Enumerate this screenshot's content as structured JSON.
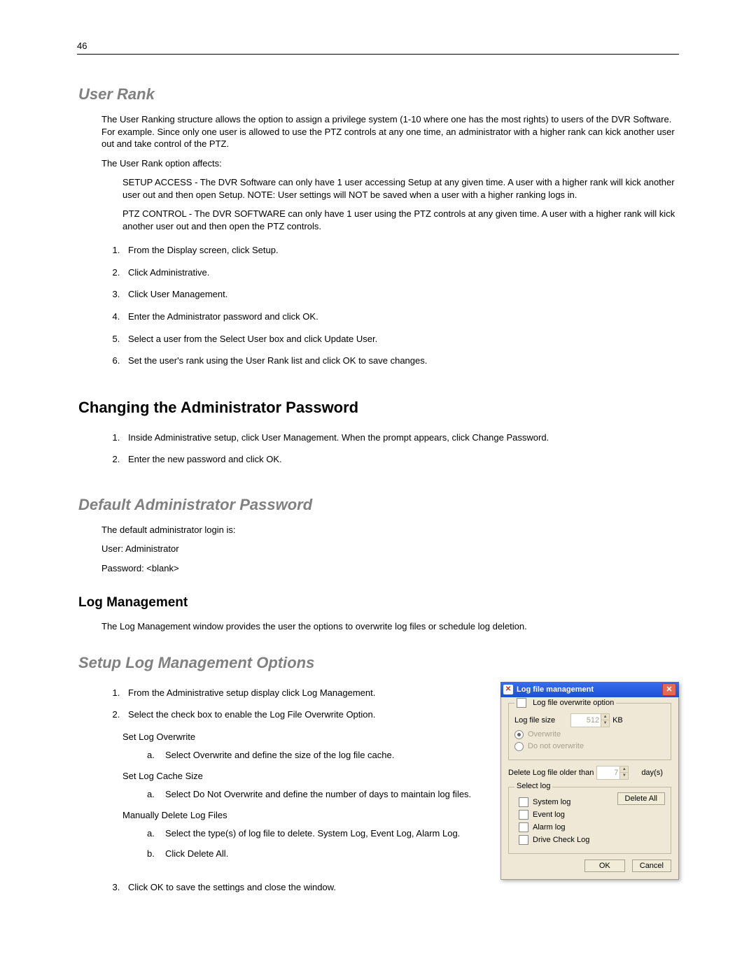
{
  "page_number": "46",
  "s1": {
    "heading": "User Rank",
    "p1": "The User Ranking structure allows the option to assign a privilege system (1-10 where one has the most rights) to users of the DVR Software.  For example.  Since only one user is allowed to use the PTZ controls at any one time, an administrator with a higher rank can kick another user out and take control of the PTZ.",
    "p2": "The User Rank option affects:",
    "setup_head": "SETUP ACCESS",
    "setup_body": " - The DVR Software can only have 1 user accessing Setup at any given time.  A user with a higher rank will kick another user out and then open Setup.  NOTE:  User settings will NOT be saved when a user with a higher ranking logs in.",
    "ptz_head": "PTZ CONTROL",
    "ptz_body": " - The DVR SOFTWARE can only have 1 user using the PTZ controls at any given time.  A user with a higher rank will kick another user out and then open the PTZ controls.",
    "steps": [
      {
        "pre": "From the Display screen, click ",
        "b1": "Setup",
        "post": "."
      },
      {
        "pre": "Click ",
        "b1": "Administrative",
        "post": "."
      },
      {
        "pre": "Click ",
        "b1": "User Management",
        "post": "."
      },
      {
        "pre": "Enter the Administrator ",
        "b1": "password",
        "post": " and click OK."
      },
      {
        "full": "Select a user from the Select User box and click Update User."
      },
      {
        "full": "Set the user's rank using the User Rank list and click OK to save changes."
      }
    ]
  },
  "s2": {
    "heading": "Changing the Administrator Password",
    "steps": [
      "Inside Administrative setup, click User Management. When the prompt appears, click Change Password.",
      "Enter the new password and click OK."
    ]
  },
  "s3": {
    "heading": "Default Administrator Password",
    "p1": "The default administrator login is:",
    "p2": "User: Administrator",
    "p3": "Password: <blank>"
  },
  "s4": {
    "heading": "Log Management",
    "p1": "The Log Management window provides the user the options to overwrite log files or schedule log deletion."
  },
  "s5": {
    "heading": "Setup Log Management Options",
    "steps": {
      "1": "From the Administrative setup display click Log Management.",
      "2": "Select the check box to enable the Log File Overwrite Option.",
      "3": "Click OK to save the settings and close the window."
    },
    "sub_overwrite": "Set Log Overwrite",
    "sub_overwrite_a": "Select Overwrite and define the size of the log file cache.",
    "sub_cache": "Set Log Cache Size",
    "sub_cache_a": "Select Do Not Overwrite and define the number of days to maintain log files.",
    "sub_manual": "Manually Delete Log Files",
    "sub_manual_a": "Select the type(s) of log file to delete.  System Log, Event Log, Alarm Log.",
    "sub_manual_b": "Click Delete All."
  },
  "dialog": {
    "title": "Log file management",
    "group1_legend": "Log file overwrite option",
    "logfilesize_label": "Log file size",
    "logfilesize_value": "512",
    "kb": "KB",
    "overwrite": "Overwrite",
    "donot": "Do not overwrite",
    "delete_older": "Delete Log file older than",
    "days_value": "7",
    "days_unit": "day(s)",
    "group2_legend": "Select log",
    "logs": [
      "System log",
      "Event log",
      "Alarm log",
      "Drive Check Log"
    ],
    "delete_all": "Delete All",
    "ok": "OK",
    "cancel": "Cancel"
  }
}
